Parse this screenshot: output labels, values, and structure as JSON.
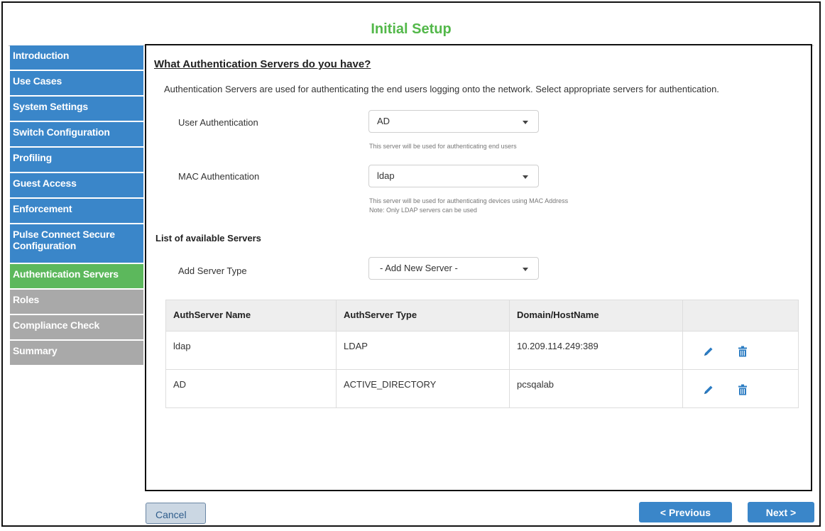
{
  "window": {
    "title": "Initial Setup"
  },
  "sidebar": {
    "items": [
      {
        "label": "Introduction",
        "state": "done"
      },
      {
        "label": "Use Cases",
        "state": "done"
      },
      {
        "label": "System Settings",
        "state": "done"
      },
      {
        "label": "Switch Configuration",
        "state": "done"
      },
      {
        "label": "Profiling",
        "state": "done"
      },
      {
        "label": "Guest Access",
        "state": "done"
      },
      {
        "label": "Enforcement",
        "state": "done"
      },
      {
        "label": "Pulse Connect Secure Configuration",
        "state": "done"
      },
      {
        "label": "Authentication Servers",
        "state": "active"
      },
      {
        "label": "Roles",
        "state": "pending"
      },
      {
        "label": "Compliance Check",
        "state": "pending"
      },
      {
        "label": "Summary",
        "state": "pending"
      }
    ]
  },
  "main": {
    "question": "What Authentication Servers do you have?",
    "description": "Authentication Servers are used for authenticating the end users logging onto the network. Select appropriate servers for authentication.",
    "user_auth": {
      "label": "User Authentication",
      "value": "AD",
      "hint": "This server will be used for authenticating end users"
    },
    "mac_auth": {
      "label": "MAC Authentication",
      "value": "ldap",
      "hint_line1": "This server will be used for authenticating devices using MAC Address",
      "hint_line2": "Note: Only LDAP servers can be used"
    },
    "list_title": "List of available Servers",
    "add_server": {
      "label": "Add Server Type",
      "value": "- Add New Server -"
    },
    "table": {
      "headers": [
        "AuthServer Name",
        "AuthServer Type",
        "Domain/HostName",
        ""
      ],
      "rows": [
        {
          "name": "ldap",
          "type": "LDAP",
          "host": "10.209.114.249:389"
        },
        {
          "name": "AD",
          "type": "ACTIVE_DIRECTORY",
          "host": "pcsqalab"
        }
      ]
    }
  },
  "footer": {
    "cancel": "Cancel",
    "previous": "< Previous",
    "next": "Next >"
  },
  "colors": {
    "accent_green": "#53b84a",
    "nav_done": "#3a86c9",
    "nav_active": "#5cb85c",
    "nav_pending": "#a9a9a9",
    "icon_blue": "#2b7cc3"
  },
  "icons": [
    "pencil-icon",
    "trash-icon",
    "chevron-down-icon"
  ]
}
